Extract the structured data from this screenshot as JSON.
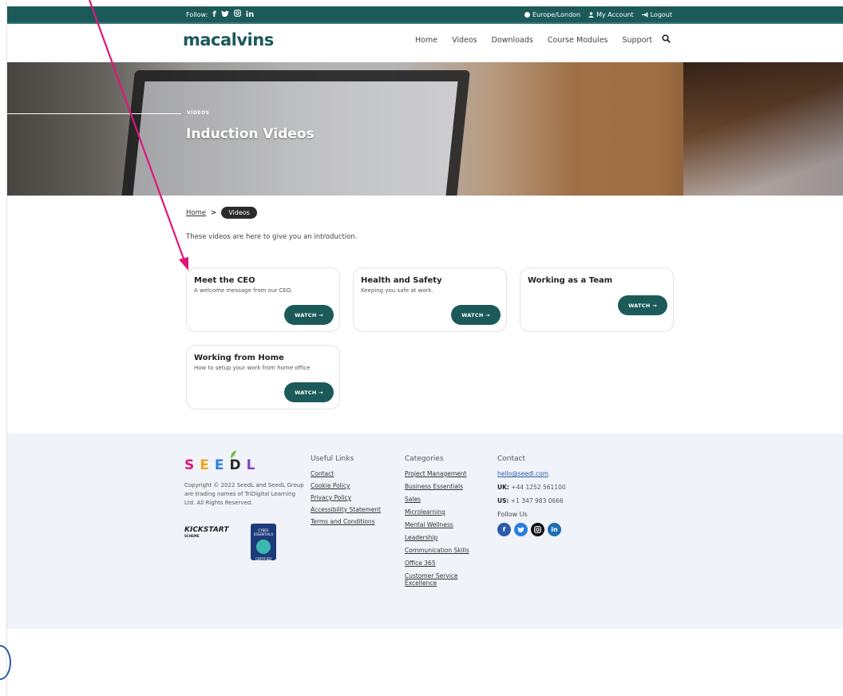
{
  "topbar": {
    "follow_label": "Follow:",
    "social_icons": [
      "facebook-icon",
      "twitter-icon",
      "instagram-icon",
      "linkedin-icon"
    ],
    "timezone": "Europe/London",
    "account": "My Account",
    "logout": "Logout"
  },
  "header": {
    "logo": "macalvins",
    "nav": [
      "Home",
      "Videos",
      "Downloads",
      "Course Modules",
      "Support"
    ]
  },
  "hero": {
    "eyebrow": "VIDEOS",
    "title": "Induction Videos"
  },
  "breadcrumb": {
    "home": "Home",
    "separator": ">",
    "current": "Videos"
  },
  "intro": "These videos are here to give you an introduction.",
  "cards": [
    {
      "title": "Meet the CEO",
      "subtitle": "A welcome message from our CEO.",
      "button": "WATCH →"
    },
    {
      "title": "Health and Safety",
      "subtitle": "Keeping you safe at work.",
      "button": "WATCH →"
    },
    {
      "title": "Working as a Team",
      "subtitle": "",
      "button": "WATCH →"
    },
    {
      "title": "Working from Home",
      "subtitle": "How to setup your work from home office",
      "button": "WATCH →"
    }
  ],
  "footer": {
    "brand_letters": [
      "S",
      "E",
      "E",
      "D",
      "L"
    ],
    "copyright": "Copyright © 2022 SeedL and SeedL Group are trading names of TriDigital Learning Ltd. All Rights Reserved.",
    "kickstart": "KICKSTART",
    "kickstart_sub": "SCHEME",
    "cyber_top": "CYBER ESSENTIALS",
    "cyber_bottom": "CERTIFIED",
    "useful_links": {
      "heading": "Useful Links",
      "items": [
        "Contact",
        "Cookie Policy",
        "Privacy Policy",
        "Accessibility Statement",
        "Terms and Conditions"
      ]
    },
    "categories": {
      "heading": "Categories",
      "items": [
        "Project Management",
        "Business Essentials",
        "Sales",
        "Microlearning",
        "Mental Wellness",
        "Leadership",
        "Communication Skills",
        "Office 365",
        "Customer Service Excellence"
      ]
    },
    "contact": {
      "heading": "Contact",
      "email": "hello@seedl.com",
      "uk_label": "UK:",
      "uk_phone": "+44 1252 561100",
      "us_label": "US:",
      "us_phone": "+1 347 983 0666",
      "follow_us": "Follow Us"
    }
  },
  "colors": {
    "brand_teal": "#1c5a5a",
    "arrow": "#e0157a",
    "footer_bg": "#f1f3fb"
  }
}
